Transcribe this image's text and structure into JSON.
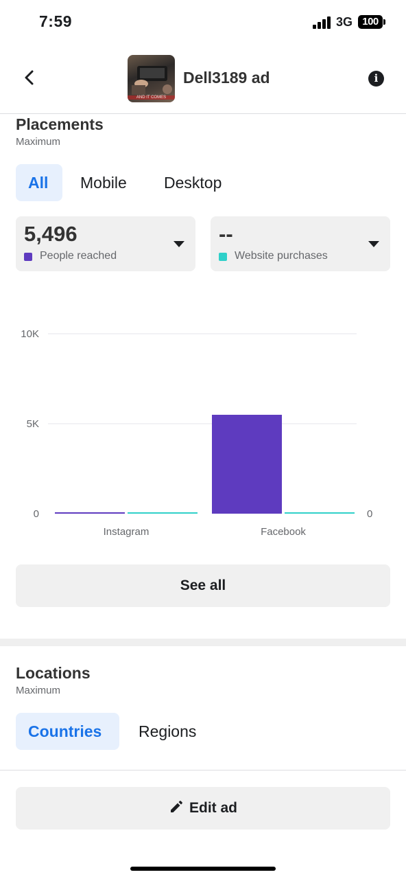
{
  "status_bar": {
    "time": "7:59",
    "network": "3G",
    "battery": "100"
  },
  "header": {
    "title": "Dell3189 ad",
    "thumbnail_caption": "AND IT COMES"
  },
  "placements": {
    "title": "Placements",
    "subtitle": "Maximum",
    "tabs": [
      "All",
      "Mobile",
      "Desktop"
    ],
    "active_tab": "All",
    "metrics": [
      {
        "value": "5,496",
        "label": "People reached",
        "color": "#5e3bbf"
      },
      {
        "value": "--",
        "label": "Website purchases",
        "color": "#2fd0c9"
      }
    ],
    "see_all_label": "See all"
  },
  "chart_data": {
    "type": "bar",
    "categories": [
      "Instagram",
      "Facebook"
    ],
    "series": [
      {
        "name": "People reached",
        "values": [
          0,
          5496
        ],
        "color": "#5e3bbf"
      },
      {
        "name": "Website purchases",
        "values": [
          0,
          0
        ],
        "color": "#2fd0c9"
      }
    ],
    "y_ticks_left": [
      "0",
      "5K",
      "10K"
    ],
    "y_tick_values": [
      0,
      5000,
      10000
    ],
    "y_tick_right": "0",
    "ylim": [
      0,
      10000
    ],
    "grid": true
  },
  "locations": {
    "title": "Locations",
    "subtitle": "Maximum",
    "tabs": [
      "Countries",
      "Regions"
    ],
    "active_tab": "Countries"
  },
  "footer": {
    "edit_label": "Edit ad"
  },
  "colors": {
    "accent": "#1a73e8",
    "accent_bg": "#e7f0fd"
  }
}
